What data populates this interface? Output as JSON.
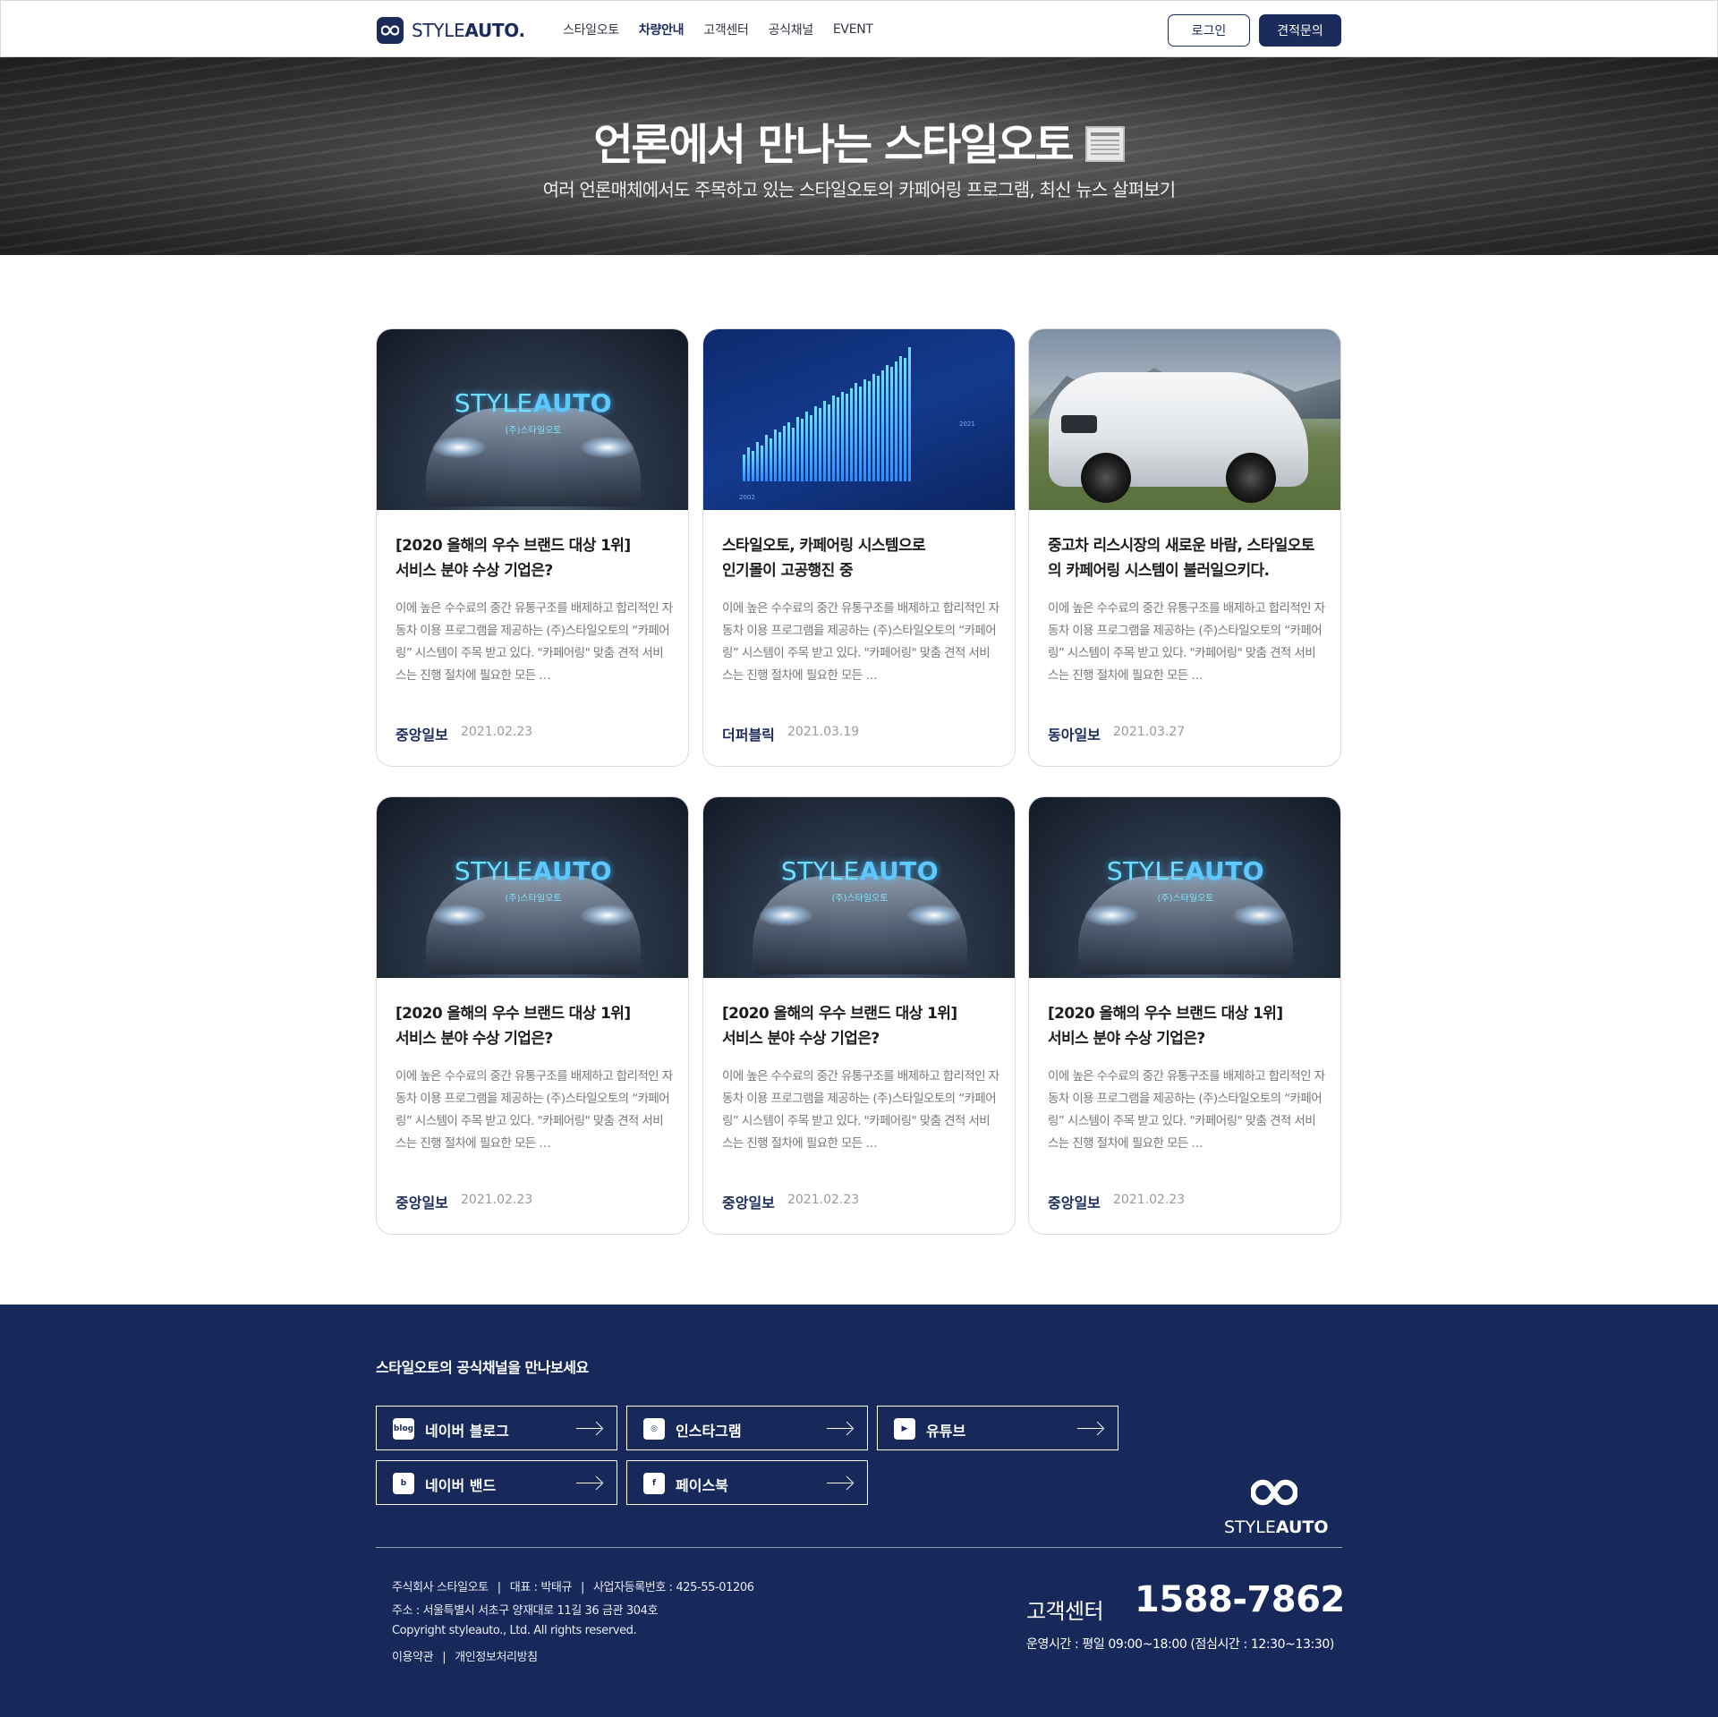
{
  "header": {
    "logo_brand_light": "STYLE",
    "logo_brand_bold": "AUTO.",
    "nav": [
      "스타일오토",
      "차량안내",
      "고객센터",
      "공식채널",
      "EVENT"
    ],
    "login": "로그인",
    "quote": "견적문의"
  },
  "hero": {
    "title": "언론에서 만나는 스타일오토",
    "subtitle": "여러 언론매체에서도 주목하고 있는 스타일오토의 카페어링 프로그램, 최신 뉴스 살펴보기"
  },
  "cards": [
    {
      "image": "brand",
      "title1": "[2020 올해의 우수 브랜드 대상 1위]",
      "title2": "서비스 분야 수상 기업은?",
      "body": "이에 높은 수수료의 중간 유통구조를 배제하고 합리적인 자동차 이용 프로그램을 제공하는 (주)스타일오토의 “카페어링” 시스템이 주목 받고 있다. \"카페어링\" 맞춤 견적 서비스는 진행 절차에 필요한 모든 …",
      "source": "중앙일보",
      "date": "2021.02.23"
    },
    {
      "image": "chart",
      "title1": "스타일오토, 카페어링 시스템으로",
      "title2": "인기몰이 고공행진 중",
      "body": "이에 높은 수수료의 중간 유통구조를 배제하고 합리적인 자동차 이용 프로그램을 제공하는 (주)스타일오토의 “카페어링” 시스템이 주목 받고 있다. \"카페어링\" 맞춤 견적 서비스는 진행 절차에 필요한 모든 …",
      "source": "더퍼블릭",
      "date": "2021.03.19"
    },
    {
      "image": "suv",
      "title1": "중고차 리스시장의 새로운 바람, 스타일오토",
      "title2": "의 카페어링 시스템이 불러일으키다.",
      "body": "이에 높은 수수료의 중간 유통구조를 배제하고 합리적인 자동차 이용 프로그램을 제공하는 (주)스타일오토의 “카페어링” 시스템이 주목 받고 있다. \"카페어링\" 맞춤 견적 서비스는 진행 절차에 필요한 모든 …",
      "source": "동아일보",
      "date": "2021.03.27"
    },
    {
      "image": "brand",
      "title1": "[2020 올해의 우수 브랜드 대상 1위]",
      "title2": "서비스 분야 수상 기업은?",
      "body": "이에 높은 수수료의 중간 유통구조를 배제하고 합리적인 자동차 이용 프로그램을 제공하는 (주)스타일오토의 “카페어링” 시스템이 주목 받고 있다. \"카페어링\" 맞춤 견적 서비스는 진행 절차에 필요한 모든 …",
      "source": "중앙일보",
      "date": "2021.02.23"
    },
    {
      "image": "brand",
      "title1": "[2020 올해의 우수 브랜드 대상 1위]",
      "title2": "서비스 분야 수상 기업은?",
      "body": "이에 높은 수수료의 중간 유통구조를 배제하고 합리적인 자동차 이용 프로그램을 제공하는 (주)스타일오토의 “카페어링” 시스템이 주목 받고 있다. \"카페어링\" 맞춤 견적 서비스는 진행 절차에 필요한 모든 …",
      "source": "중앙일보",
      "date": "2021.02.23"
    },
    {
      "image": "brand",
      "title1": "[2020 올해의 우수 브랜드 대상 1위]",
      "title2": "서비스 분야 수상 기업은?",
      "body": "이에 높은 수수료의 중간 유통구조를 배제하고 합리적인 자동차 이용 프로그램을 제공하는 (주)스타일오토의 “카페어링” 시스템이 주목 받고 있다. \"카페어링\" 맞춤 견적 서비스는 진행 절차에 필요한 모든 …",
      "source": "중앙일보",
      "date": "2021.02.23"
    }
  ],
  "card_image_text": {
    "brand_light": "STYLE",
    "brand_bold": "AUTO",
    "brand_sub": "(주)스타일오토",
    "chart_year_start": "2002",
    "chart_year_end": "2021"
  },
  "footer": {
    "heading": "스타일오토의 공식채널을 만나보세요",
    "channels": [
      {
        "label": "네이버 블로그",
        "icon": "blog-icon",
        "badge": "blog"
      },
      {
        "label": "인스타그램",
        "icon": "instagram-icon",
        "badge": "◎"
      },
      {
        "label": "유튜브",
        "icon": "youtube-icon",
        "badge": "▶"
      },
      {
        "label": "네이버 밴드",
        "icon": "band-icon",
        "badge": "b"
      },
      {
        "label": "페이스북",
        "icon": "facebook-icon",
        "badge": "f"
      }
    ],
    "logo_light": "STYLE",
    "logo_bold": "AUTO",
    "company": "주식회사 스타일오토",
    "ceo": "대표 : 박태규",
    "biz_no": "사업자등록번호 : 425-55-01206",
    "address": "주소 : 서울특별시 서초구 양재대로 11길 36 금관 304호",
    "copyright": "Copyright styleauto., Ltd. All rights reserved.",
    "terms": "이용약관",
    "privacy": "개인정보처리방침",
    "cc_label": "고객센터",
    "cc_phone": "1588-7862",
    "hours": "운영시간 : 평일 09:00~18:00 (점심시간 : 12:30~13:30)"
  },
  "colors": {
    "navy": "#1b2b5c",
    "footer_bg": "#17295b"
  }
}
